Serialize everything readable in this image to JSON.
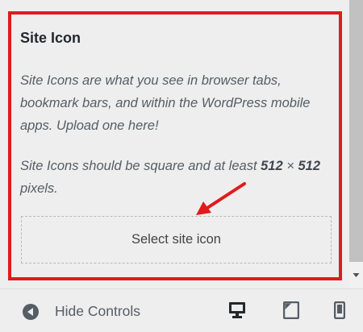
{
  "section": {
    "title": "Site Icon",
    "description": "Site Icons are what you see in browser tabs, bookmark bars, and within the WordPress mobile apps. Upload one here!",
    "requirement": {
      "prefix": "Site Icons should be square and at least ",
      "width": "512",
      "times": " × ",
      "height": "512",
      "suffix": " pixels."
    },
    "select_button": "Select site icon"
  },
  "footer": {
    "hide_controls": "Hide Controls",
    "devices": [
      "desktop-icon",
      "tablet-icon",
      "mobile-icon"
    ]
  },
  "colors": {
    "highlight": "#e01b1b",
    "active_device": "#23282d",
    "panel_bg": "#eeeeee"
  },
  "icons": {
    "hide": "arrow-left-circle-icon",
    "annotation": "red-arrow-annotation"
  }
}
